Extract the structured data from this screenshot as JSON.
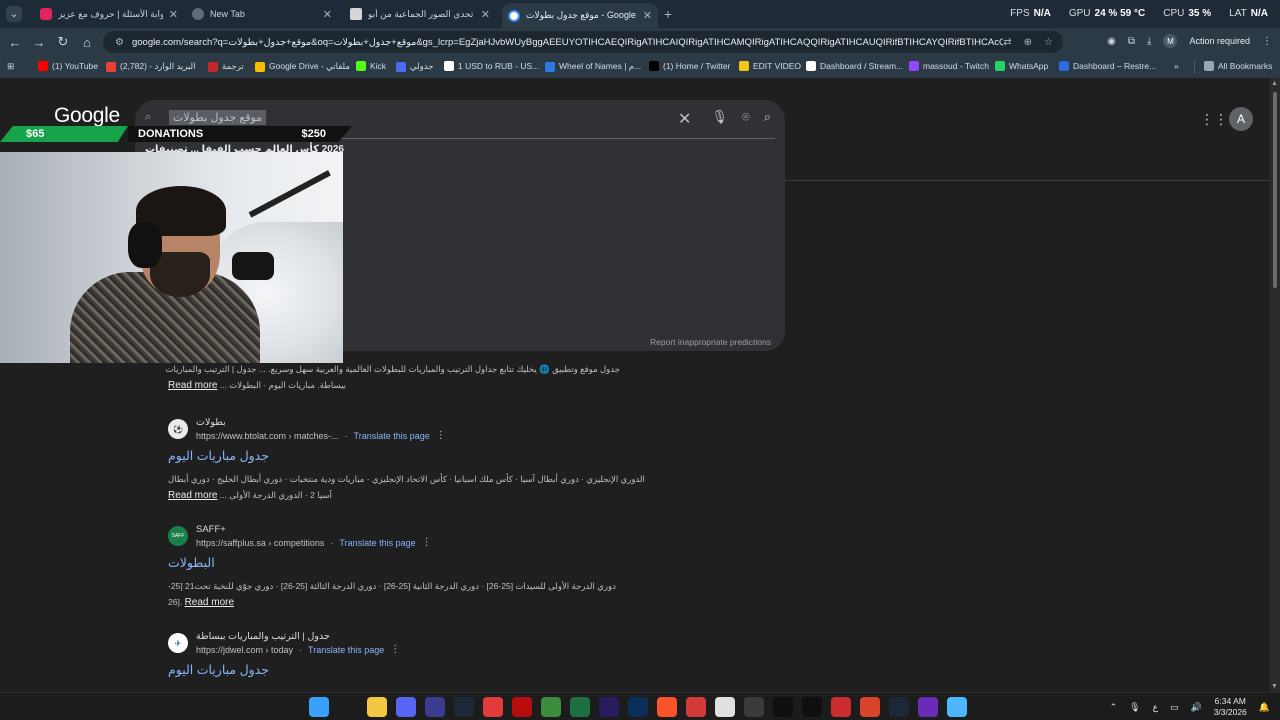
{
  "tabs": [
    {
      "title": "بوابة الأسئلة | حروف مع عزيز",
      "favicon_color": "#e3245d"
    },
    {
      "title": "New Tab",
      "favicon_color": "#5f6b75"
    },
    {
      "title": "لعبة تحدي الصور الجماعية من أبو",
      "favicon_color": "#d6d6d6"
    },
    {
      "title": "موقع جدول بطولات - Google Search",
      "favicon_color": "#4285f4",
      "active": true
    }
  ],
  "perf": {
    "fps_label": "FPS",
    "fps_value": "N/A",
    "gpu_label": "GPU",
    "gpu_value": "24 % 59 °C",
    "cpu_label": "CPU",
    "cpu_value": "35 %",
    "lat_label": "LAT",
    "lat_value": "N/A"
  },
  "address": {
    "url": "google.com/search?q=موقع+جدول+بطولات&oq=موقع+جدول+بطولات&gs_lcrp=EgZjaHJvbWUyBggAEEUYOTIHCAEQIRigATIHCAIQIRigATIHCAMQIRigATIHCAQQIRigATIHCAUQIRifBTIHCAYQIRifBTIHCAcQIRifBTIH...",
    "action_required": "Action required",
    "profile_initial": "M"
  },
  "bookmarks": [
    {
      "label": "(1) YouTube",
      "color": "#ff0000"
    },
    {
      "label": "(2,782) - البريد الوارد",
      "color": "#ea4335"
    },
    {
      "label": "ترجمة",
      "color": "#c1272d"
    },
    {
      "label": "Google Drive - ملفاتي",
      "color": "#fbbc04"
    },
    {
      "label": "Kick",
      "color": "#53fc18"
    },
    {
      "label": "جدولي",
      "color": "#4a6cf7"
    },
    {
      "label": "1 USD to RUB - US...",
      "color": "#ffffff"
    },
    {
      "label": "Wheel of Names | م...",
      "color": "#2c7be5"
    },
    {
      "label": "(1) Home / Twitter",
      "color": "#000000"
    },
    {
      "label": "EDIT VIDEO",
      "color": "#f5c518"
    },
    {
      "label": "Dashboard / Stream...",
      "color": "#ffffff"
    },
    {
      "label": "massoud - Twitch",
      "color": "#9146ff"
    },
    {
      "label": "WhatsApp",
      "color": "#25d366"
    },
    {
      "label": "Dashboard – Restre...",
      "color": "#2d6cdf"
    }
  ],
  "all_bookmarks": "All Bookmarks",
  "google": {
    "logo": "Google",
    "query": "موقع جدول بطولات",
    "suggestion": "2026 كأس العالم حسب الفيفا ... تصنيفات",
    "report": "Report inappropriate predictions",
    "avatar_initial": "A"
  },
  "donations": {
    "left_amount": "$65",
    "label": "DONATIONS",
    "right_amount": "$250"
  },
  "first_snippet": {
    "line1": "جدول موقع وتطبيق 🌐 يخليك تتابع جداول الترتيب والمباريات للبطولات العالمية والعربية سهل وسريع. ... جدول | الترتيب والمباريات",
    "line2": "بيساطة. مباريات اليوم · البطولات ...",
    "read_more": "Read more"
  },
  "results": [
    {
      "site_name": "بطولات",
      "url": "https://www.btolat.com › matches-...",
      "translate": "Translate this page",
      "title": "جدول مباريات اليوم",
      "snippet1": "الدوري الإنجليزي · دوري أبطال آسيا · كأس ملك اسبانيا · كأس الاتحاد الإنجليزي · مباريات ودية منتخبات · دوري أبطال الخليج · دوري أبطال",
      "snippet2": "آسيا 2 · الدوري الدرجة الأولى ...",
      "read_more": "Read more",
      "icon_text": "⚽"
    },
    {
      "site_name": "SAFF+",
      "url": "https://saffplus.sa › competitions",
      "translate": "Translate this page",
      "title": "البطولات",
      "snippet1": "دوري الدرجة الأولى للسيدات [25-26] · دوري الدرجة الثانية [25-26] · دوري الدرجة الثالثة [25-26] · دوري جوّي للنخبة تحت21 [25-",
      "snippet2": "26].",
      "read_more": "Read more",
      "icon_text": "SAFF"
    },
    {
      "site_name": "جدول | الترتيب والمباريات ببساطة",
      "url": "https://jdwel.com › today",
      "translate": "Translate this page",
      "title": "جدول مباريات اليوم",
      "snippet1": "",
      "snippet2": "",
      "read_more": "",
      "icon_text": "✈"
    }
  ],
  "taskbar": {
    "time": "6:34 AM",
    "date": "3/3/2026",
    "lang": "ع",
    "icons": [
      "windows",
      "search",
      "files",
      "discord",
      "media",
      "steam",
      "eu",
      "app-red",
      "app-green",
      "excel",
      "premiere",
      "photoshop",
      "brave",
      "app-red2",
      "chrome",
      "obs",
      "capcut",
      "app-dark",
      "app-red3",
      "app-orange",
      "steam2",
      "app-purple",
      "notepad"
    ]
  }
}
